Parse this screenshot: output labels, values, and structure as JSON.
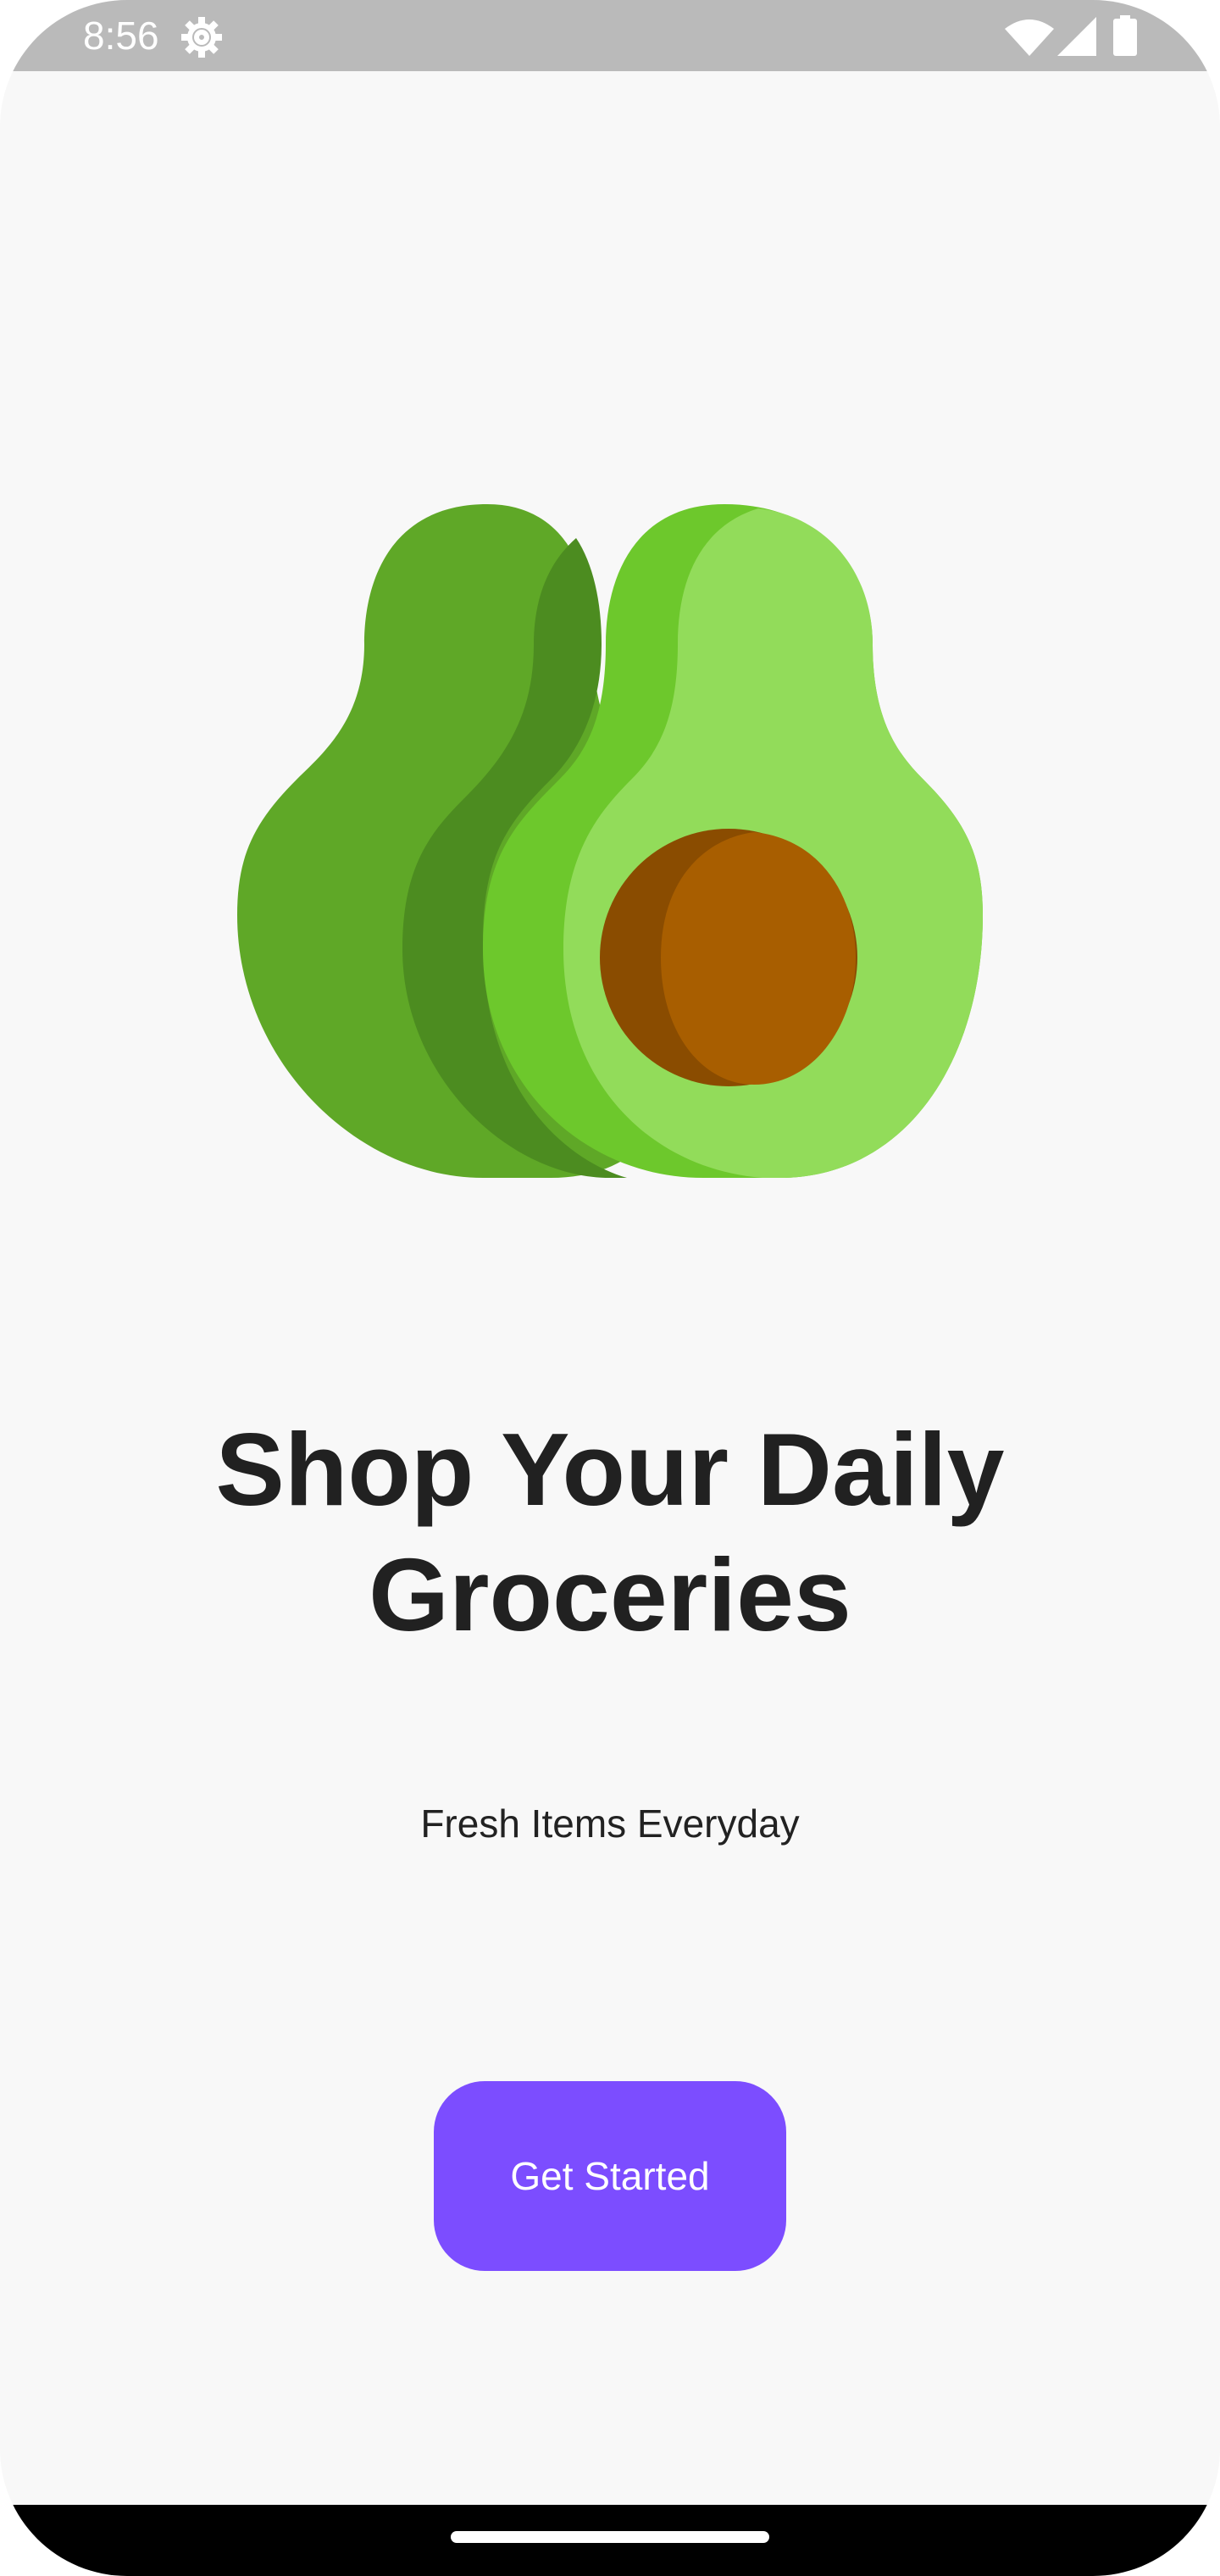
{
  "status_bar": {
    "time": "8:56",
    "icons": [
      "settings-icon",
      "wifi-icon",
      "signal-icon",
      "battery-icon"
    ],
    "background": "#bababa"
  },
  "hero": {
    "illustration": "avocado-illustration",
    "colors": {
      "dark_green": "#5fa827",
      "shadow_green": "#4c8c20",
      "mid_green": "#6dc82c",
      "light_green": "#92dc5a",
      "pit": "#a85e00",
      "pit_shadow": "#8a4c00"
    }
  },
  "onboarding": {
    "title": "Shop Your Daily Groceries",
    "subtitle": "Fresh Items Everyday",
    "cta_label": "Get Started",
    "accent": "#7c4dff"
  }
}
